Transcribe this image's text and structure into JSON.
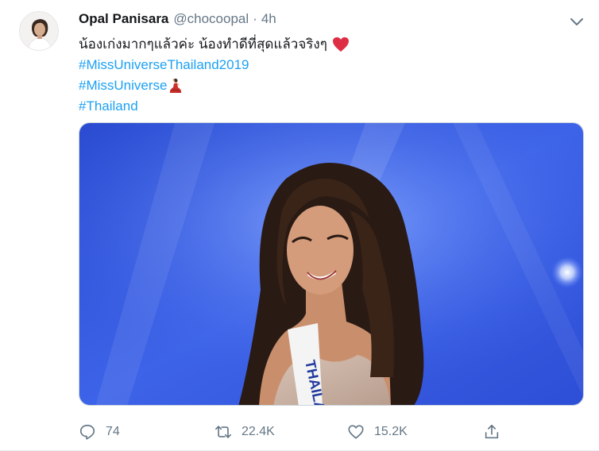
{
  "tweet": {
    "author_name": "Opal Panisara",
    "handle": "@chocoopal",
    "separator": "·",
    "time": "4h",
    "text_line": "น้องเก่งมากๆแล้วค่ะ น้องทำดีที่สุดแล้วจริงๆ",
    "hashtags": [
      "#MissUniverseThailand2019",
      "#MissUniverse",
      "#Thailand"
    ],
    "emojis": [
      "red-heart",
      "woman-dancing"
    ],
    "sash_text": "THAILA"
  },
  "actions": {
    "reply_count": "74",
    "retweet_count": "22.4K",
    "like_count": "15.2K"
  },
  "colors": {
    "link": "#1da1f2",
    "muted": "#657786",
    "heart": "#e0245e"
  }
}
